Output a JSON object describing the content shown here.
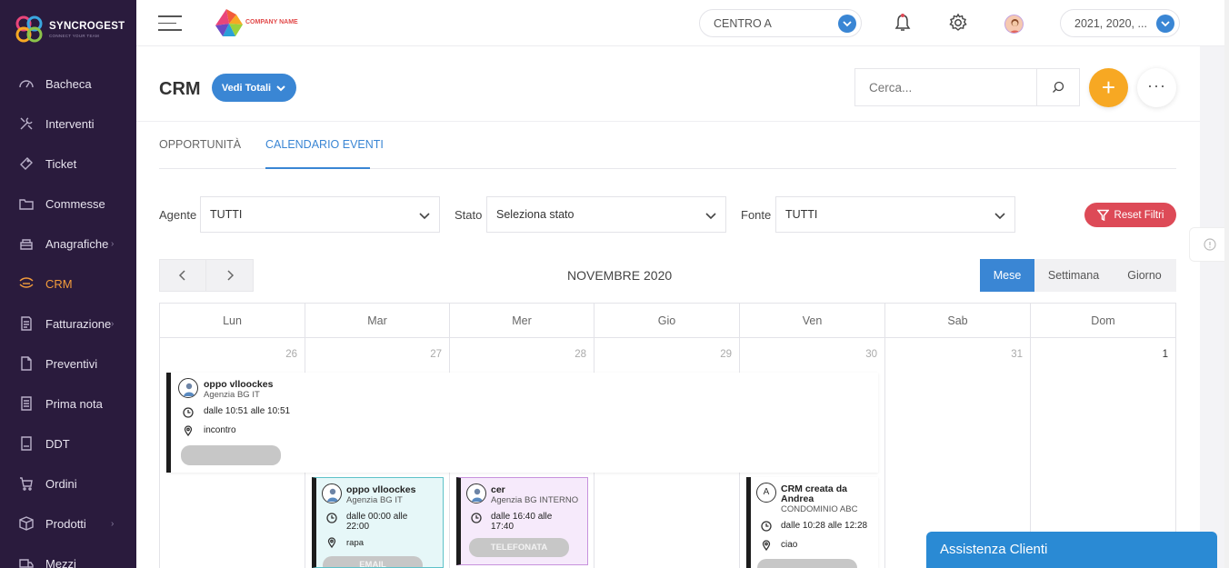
{
  "brand": {
    "name": "SYNCROGEST",
    "tagline": "CONNECT YOUR TEAM"
  },
  "company_logo_text": "COMPANY NAME",
  "topbar": {
    "centro": "CENTRO A",
    "years": "2021, 2020, ..."
  },
  "sidebar": {
    "items": [
      {
        "label": "Bacheca",
        "icon": "dashboard-icon"
      },
      {
        "label": "Interventi",
        "icon": "tools-icon"
      },
      {
        "label": "Ticket",
        "icon": "ticket-icon"
      },
      {
        "label": "Commesse",
        "icon": "folder-icon"
      },
      {
        "label": "Anagrafiche",
        "icon": "contacts-icon",
        "has_children": true
      },
      {
        "label": "CRM",
        "icon": "crm-icon",
        "active": true
      },
      {
        "label": "Fatturazione",
        "icon": "invoice-icon",
        "has_children": true
      },
      {
        "label": "Preventivi",
        "icon": "quote-icon"
      },
      {
        "label": "Prima nota",
        "icon": "notes-icon"
      },
      {
        "label": "DDT",
        "icon": "ddt-icon"
      },
      {
        "label": "Ordini",
        "icon": "cart-icon"
      },
      {
        "label": "Prodotti",
        "icon": "box-icon",
        "has_children": true
      },
      {
        "label": "Mezzi",
        "icon": "truck-icon"
      }
    ]
  },
  "page": {
    "title": "CRM",
    "totals_button": "Vedi Totali",
    "search_placeholder": "Cerca..."
  },
  "tabs": [
    {
      "label": "OPPORTUNITÀ"
    },
    {
      "label": "CALENDARIO EVENTI",
      "active": true
    }
  ],
  "filters": {
    "agent_label": "Agente",
    "agent_value": "TUTTI",
    "state_label": "Stato",
    "state_value": "Seleziona stato",
    "source_label": "Fonte",
    "source_value": "TUTTI",
    "reset_label": "Reset Filtri"
  },
  "calendar": {
    "title": "NOVEMBRE 2020",
    "views": [
      "Mese",
      "Settimana",
      "Giorno"
    ],
    "active_view": "Mese",
    "weekdays": [
      "Lun",
      "Mar",
      "Mer",
      "Gio",
      "Ven",
      "Sab",
      "Dom"
    ],
    "days": [
      "26",
      "27",
      "28",
      "29",
      "30",
      "31",
      "1"
    ]
  },
  "events": {
    "big": {
      "title": "oppo vlloockes",
      "subtitle": "Agenzia BG IT",
      "time": "dalle 10:51 alle 10:51",
      "place": "incontro",
      "tag": ""
    },
    "mar": {
      "title": "oppo vlloockes",
      "subtitle": "Agenzia BG IT",
      "time1": "dalle 00:00 alle",
      "time2": "22:00",
      "place": "rapa",
      "tag": "EMAIL",
      "border_color": "#1c1c1c",
      "bg": "#e6f7f8"
    },
    "mer": {
      "title": "cer",
      "subtitle": "Agenzia BG INTERNO",
      "time1": "dalle 16:40 alle",
      "time2": "17:40",
      "place": "",
      "tag": "TELEFONATA",
      "bg": "#f6eafb"
    },
    "ven": {
      "avatar_letter": "A",
      "title1": "CRM creata da",
      "title2": "Andrea",
      "subtitle": "CONDOMINIO ABC",
      "time": "dalle 10:28 alle 12:28",
      "place": "ciao"
    }
  },
  "assistance": "Assistenza Clienti",
  "colors": {
    "sidebar": "#2a1b3d",
    "accent": "#3a86d4",
    "active": "#f39c3b",
    "add": "#f7a823",
    "reset": "#dd4a57"
  }
}
